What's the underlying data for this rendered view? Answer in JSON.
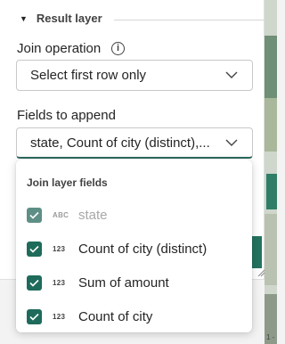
{
  "section": {
    "title": "Result layer"
  },
  "join_operation": {
    "label": "Join operation",
    "info_glyph": "i",
    "value": "Select first row only"
  },
  "fields_to_append": {
    "label": "Fields to append",
    "value": "state, Count of city (distinct),..."
  },
  "dropdown": {
    "group_label": "Join layer fields",
    "options": [
      {
        "type": "ABC",
        "label": "state",
        "checked": true,
        "disabled": true
      },
      {
        "type": "123",
        "label": "Count of city (distinct)",
        "checked": true,
        "disabled": false
      },
      {
        "type": "123",
        "label": "Sum of amount",
        "checked": true,
        "disabled": false
      },
      {
        "type": "123",
        "label": "Count of city",
        "checked": true,
        "disabled": false
      }
    ]
  },
  "map_corner_text": "1 -",
  "colors": {
    "accent": "#1e6b5b",
    "button": "#23735f",
    "text": "#242424"
  },
  "icons": {
    "section_caret": "caret-down-icon",
    "info": "info-icon",
    "chevron": "chevron-down-icon",
    "checkmark": "checkmark-icon",
    "grip": "resize-grip-icon"
  }
}
